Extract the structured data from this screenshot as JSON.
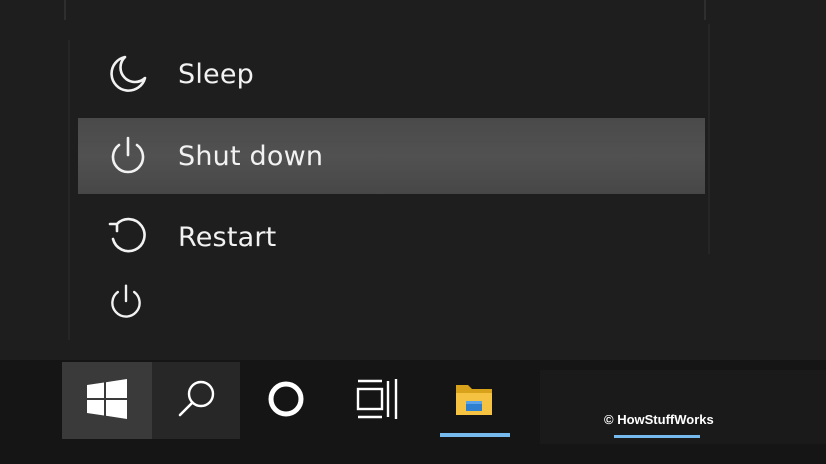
{
  "power_menu": {
    "items": [
      {
        "label": "Sleep",
        "icon": "moon-icon"
      },
      {
        "label": "Shut down",
        "icon": "power-icon",
        "highlighted": true
      },
      {
        "label": "Restart",
        "icon": "restart-icon"
      }
    ],
    "power_button": {
      "icon": "power-icon"
    }
  },
  "taskbar": {
    "buttons": [
      {
        "name": "start",
        "icon": "windows-logo-icon",
        "active": true
      },
      {
        "name": "search",
        "icon": "search-icon"
      },
      {
        "name": "cortana",
        "icon": "cortana-circle-icon"
      },
      {
        "name": "task-view",
        "icon": "task-view-icon"
      },
      {
        "name": "file-explorer",
        "icon": "folder-icon",
        "running": true
      }
    ]
  },
  "watermark": {
    "text": "© HowStuffWorks"
  },
  "colors": {
    "menu_bg": "#1e1e1e",
    "highlight": "#4d4d4d",
    "taskbar_bg": "#151515",
    "accent": "#76b9ed",
    "folder_yellow": "#f5c242",
    "folder_blue": "#2f7fd1"
  }
}
